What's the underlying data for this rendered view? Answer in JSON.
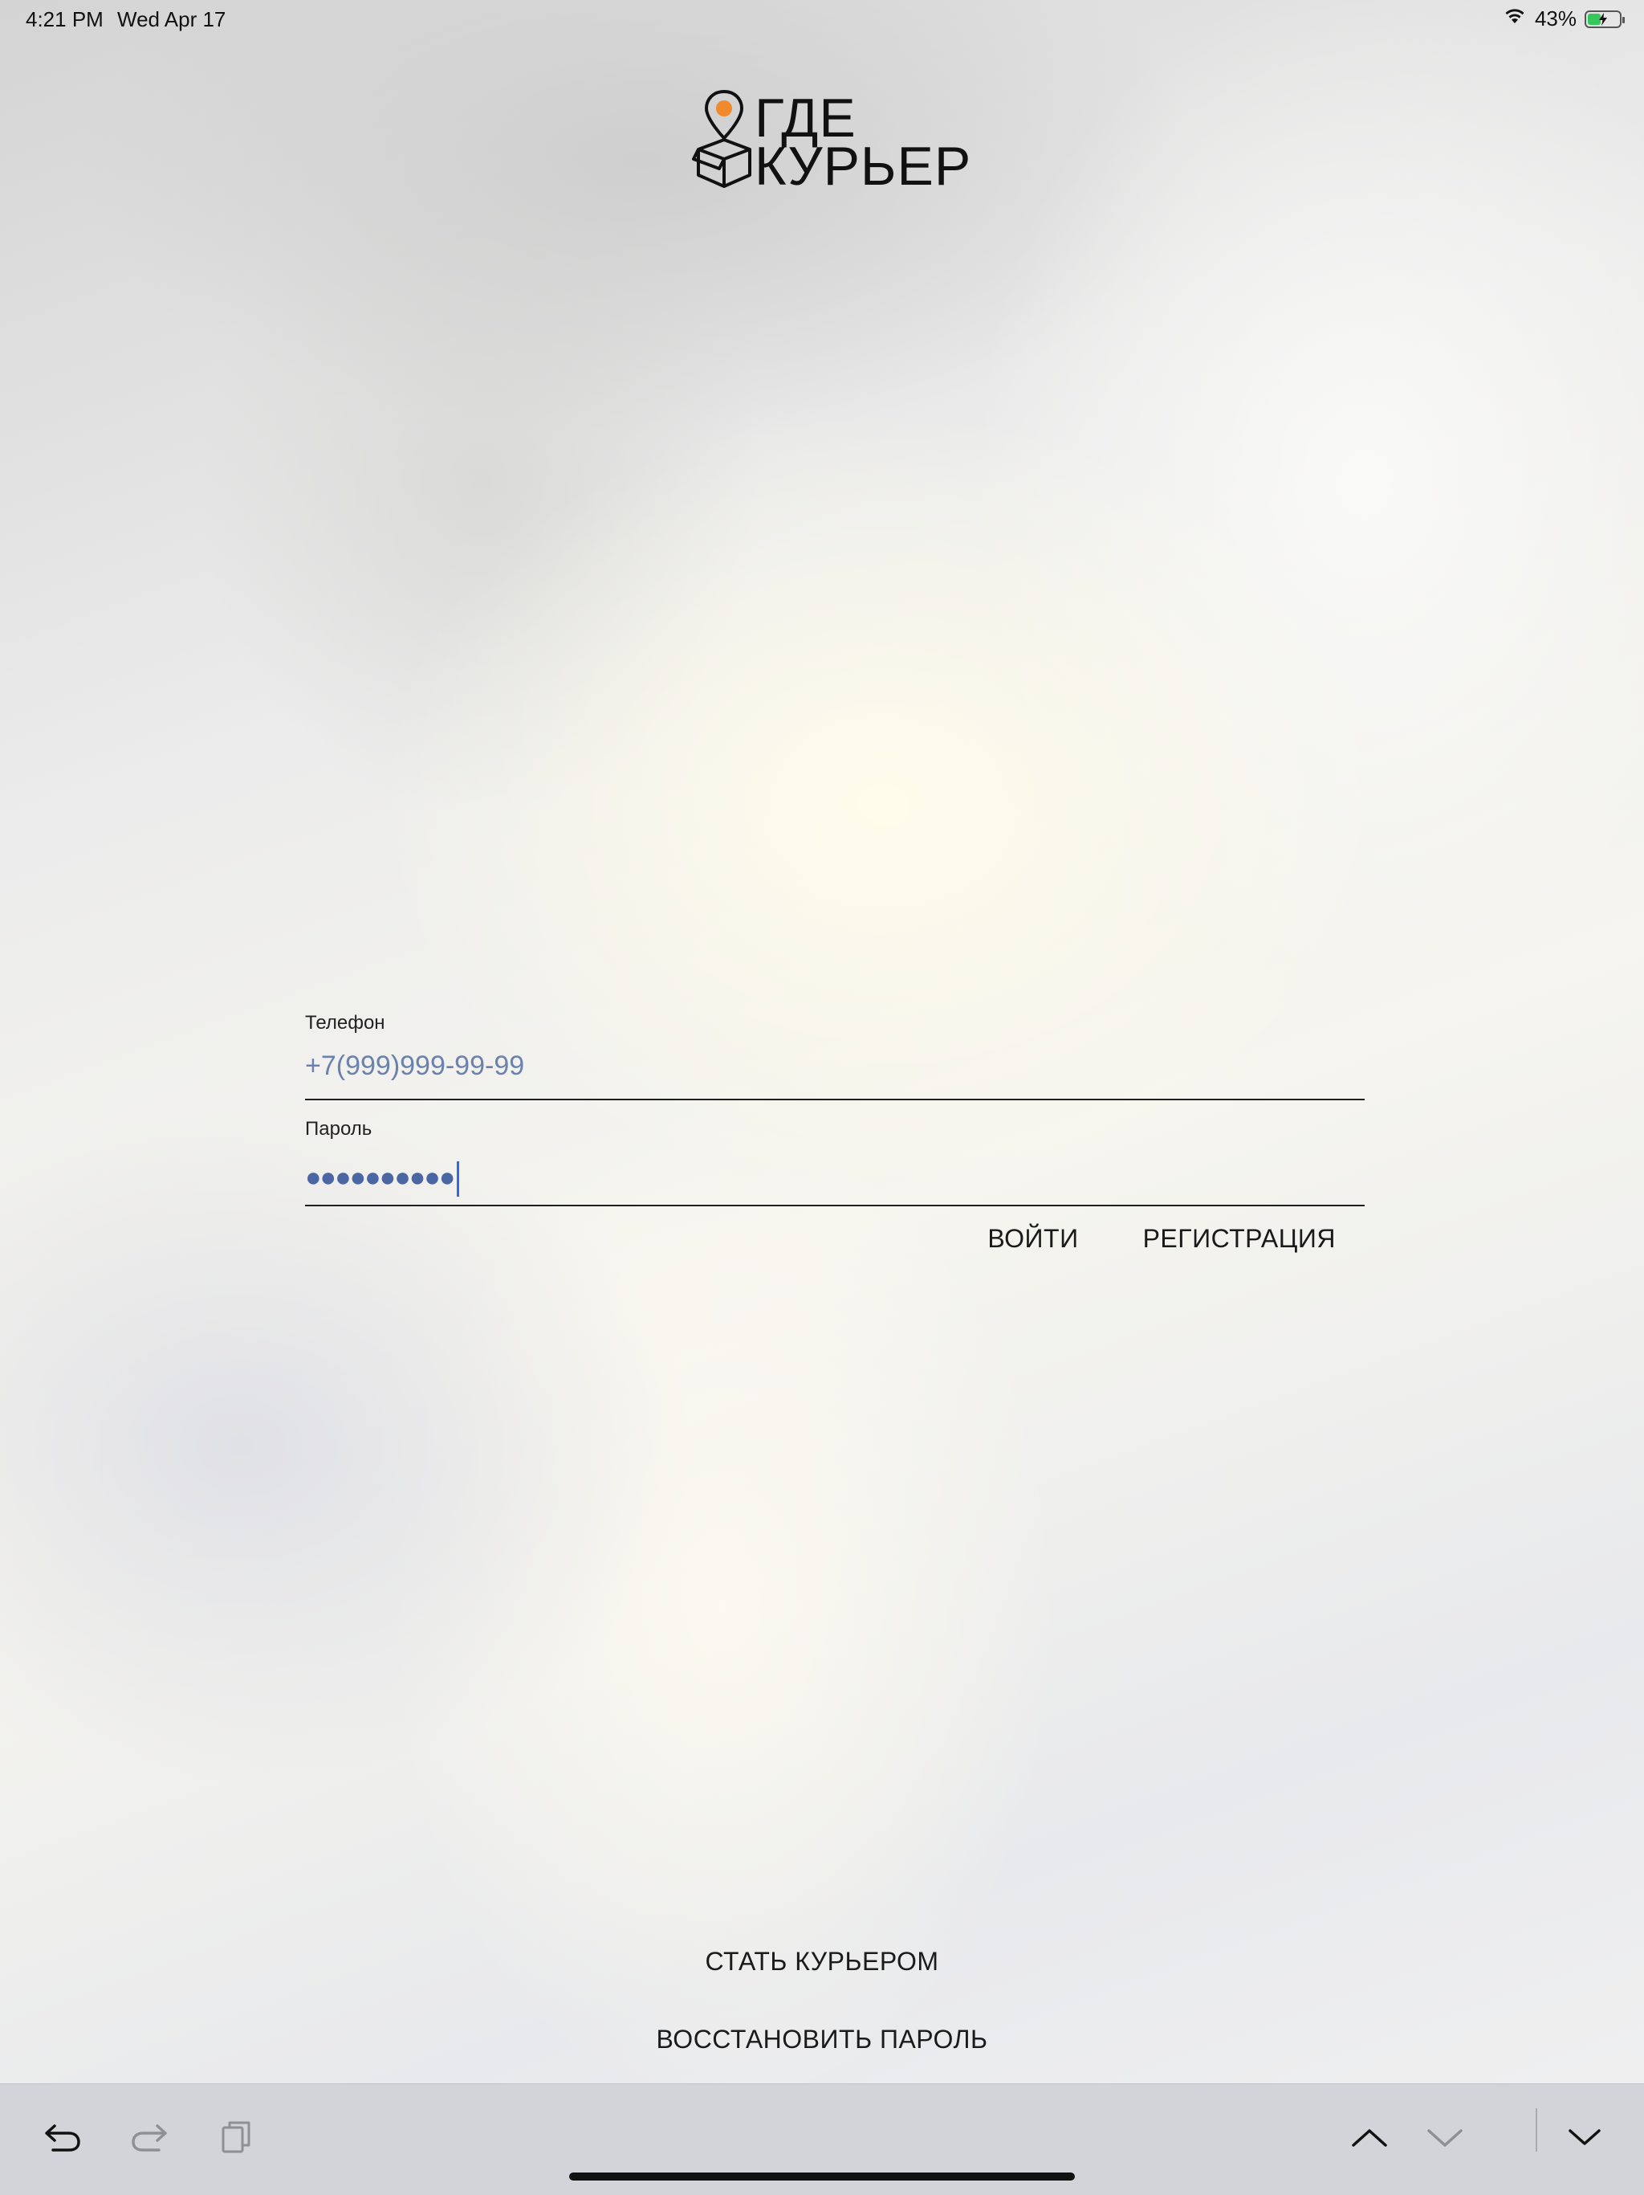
{
  "status_bar": {
    "time": "4:21 PM",
    "date": "Wed Apr 17",
    "battery_percent": "43%",
    "battery_level": 0.43,
    "wifi_icon": "wifi-icon",
    "battery_icon": "battery-charging-icon"
  },
  "logo": {
    "line1": "ГДЕ",
    "line2": "КУРЬЕР",
    "icon": "location-pin-box-icon",
    "accent_color": "#f08a2c"
  },
  "form": {
    "phone": {
      "label": "Телефон",
      "placeholder": "+7(999)999-99-99",
      "value": ""
    },
    "password": {
      "label": "Пароль",
      "masked_value": "●●●●●●●●●●"
    },
    "login_label": "ВОЙТИ",
    "register_label": "РЕГИСТРАЦИЯ"
  },
  "links": {
    "become_courier": "СТАТЬ КУРЬЕРОМ",
    "restore_password": "ВОССТАНОВИТЬ ПАРОЛЬ"
  },
  "keyboard_bar": {
    "undo_icon": "undo-icon",
    "redo_icon": "redo-icon",
    "paste_icon": "paste-icon",
    "prev_icon": "chevron-up-icon",
    "next_icon": "chevron-down-icon",
    "dismiss_icon": "keyboard-dismiss-icon"
  },
  "colors": {
    "input_text": "#5d79ad",
    "caret": "#2f6ae6",
    "toolbar_bg": "#d2d4d9"
  }
}
